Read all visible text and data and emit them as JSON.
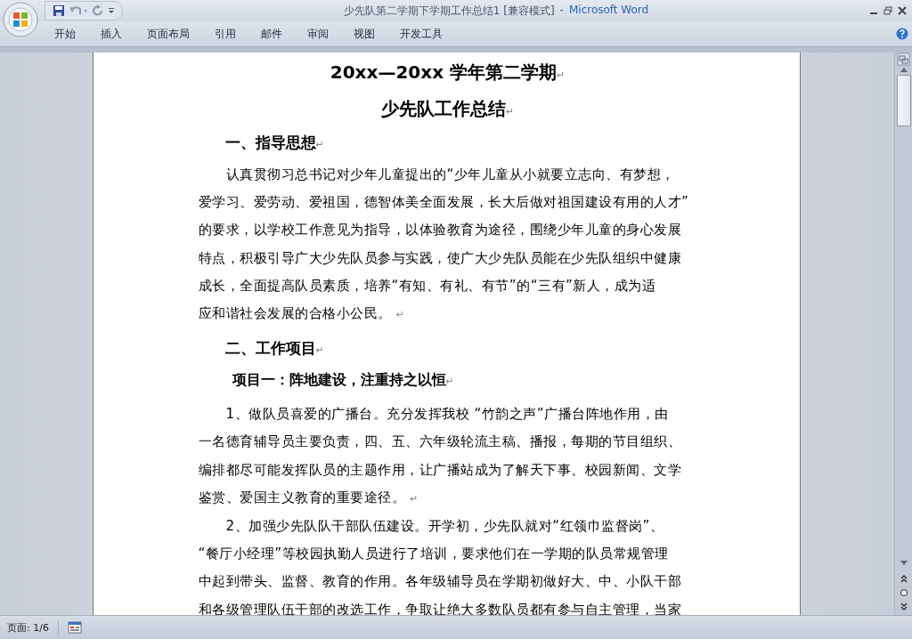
{
  "window": {
    "title": "少先队第二学期下学期工作总结1 [兼容模式]",
    "separator": "-",
    "app_name": "Microsoft Word"
  },
  "ribbon_tabs": [
    {
      "label": "开始",
      "selected": false
    },
    {
      "label": "插入",
      "selected": false
    },
    {
      "label": "页面布局",
      "selected": false
    },
    {
      "label": "引用",
      "selected": false
    },
    {
      "label": "邮件",
      "selected": false
    },
    {
      "label": "审阅",
      "selected": false
    },
    {
      "label": "视图",
      "selected": false
    },
    {
      "label": "开发工具",
      "selected": false
    }
  ],
  "document": {
    "blocks": [
      {
        "kind": "title",
        "lines": [
          "20xx—20xx 学年第二学期"
        ],
        "mark": "↵"
      },
      {
        "kind": "title",
        "lines": [
          "少先队工作总结"
        ],
        "mark": "↵"
      },
      {
        "kind": "heading",
        "lines": [
          "一、指导思想"
        ],
        "mark": "↵"
      },
      {
        "kind": "paragraph",
        "lines": [
          "认真贯彻习总书记对少年儿童提出的“少年儿童从小就要立志向、有梦想，",
          "爱学习、爱劳动、爱祖国，德智体美全面发展，长大后做对祖国建设有用的人才”",
          "的要求，以学校工作意见为指导，以体验教育为途径，围绕少年儿童的身心发展",
          "特点，积极引导广大少先队员参与实践，使广大少先队员能在少先队组织中健康",
          "成长，全面提高队员素质，培养“有知、有礼、有节”的“三有”新人，成为适",
          "应和谐社会发展的合格小公民。"
        ],
        "mark": "↵"
      },
      {
        "kind": "heading",
        "lines": [
          "二、工作项目"
        ],
        "mark": "↵"
      },
      {
        "kind": "subheading",
        "lines": [
          "项目一：阵地建设，注重持之以恒"
        ],
        "mark": "↵"
      },
      {
        "kind": "paragraph",
        "lines": [
          "1、做队员喜爱的广播台。充分发挥我校 “竹韵之声”广播台阵地作用，由",
          "一名德育辅导员主要负责，四、五、六年级轮流主稿、播报，每期的节目组织、",
          "编排都尽可能发挥队员的主题作用，让广播站成为了解天下事、校园新闻、文学",
          "鉴赏、爱国主义教育的重要途径。"
        ],
        "mark": "↵"
      },
      {
        "kind": "paragraph",
        "lines": [
          "2、加强少先队队干部队伍建设。开学初，少先队就对“红领巾监督岗”、",
          "“餐厅小经理”等校园执勤人员进行了培训，要求他们在一学期的队员常规管理",
          "中起到带头、监督、教育的作用。各年级辅导员在学期初做好大、中、小队干部",
          "和各级管理队伍干部的改选工作，争取让绝大多数队员都有参与自主管理，当家"
        ]
      }
    ]
  },
  "status_bar": {
    "page": "页面: 1/6"
  }
}
